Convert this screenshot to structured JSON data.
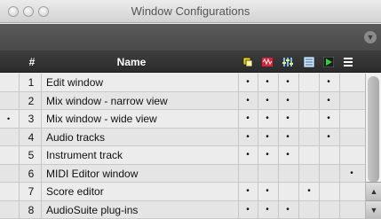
{
  "window": {
    "title": "Window Configurations"
  },
  "toolbar": {
    "menu_icon": "chevron-down-icon"
  },
  "table": {
    "headers": {
      "num": "#",
      "name": "Name"
    },
    "icon_headers": [
      {
        "name": "edit-window-column-icon",
        "color": "#f2d500"
      },
      {
        "name": "mix-window-column-icon",
        "color": "#e0203a"
      },
      {
        "name": "mixer-faders-column-icon",
        "color": "#6ec0ff"
      },
      {
        "name": "score-column-icon",
        "color": "#cfe6ff"
      },
      {
        "name": "transport-play-column-icon",
        "color": "#2fd13a"
      },
      {
        "name": "list-column-icon",
        "color": "#ffffff"
      }
    ],
    "rows": [
      {
        "num": "1",
        "name": "Edit window",
        "active": "",
        "dots": [
          "•",
          "•",
          "•",
          "",
          "•",
          ""
        ]
      },
      {
        "num": "2",
        "name": "Mix window - narrow view",
        "active": "",
        "dots": [
          "•",
          "•",
          "•",
          "",
          "•",
          ""
        ]
      },
      {
        "num": "3",
        "name": "Mix window - wide view",
        "active": "•",
        "dots": [
          "•",
          "•",
          "•",
          "",
          "•",
          ""
        ]
      },
      {
        "num": "4",
        "name": "Audio tracks",
        "active": "",
        "dots": [
          "•",
          "•",
          "•",
          "",
          "•",
          ""
        ]
      },
      {
        "num": "5",
        "name": "Instrument track",
        "active": "",
        "dots": [
          "•",
          "•",
          "•",
          "",
          "",
          ""
        ]
      },
      {
        "num": "6",
        "name": "MIDI Editor window",
        "active": "",
        "dots": [
          "",
          "",
          "",
          "",
          "",
          "•"
        ]
      },
      {
        "num": "7",
        "name": "Score editor",
        "active": "",
        "dots": [
          "•",
          "•",
          "",
          "•",
          "",
          ""
        ]
      },
      {
        "num": "8",
        "name": "AudioSuite plug-ins",
        "active": "",
        "dots": [
          "•",
          "•",
          "•",
          "",
          "",
          ""
        ]
      }
    ]
  }
}
